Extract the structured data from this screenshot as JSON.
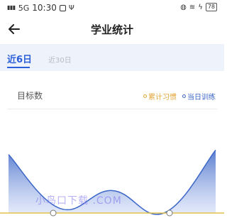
{
  "status_bar": {
    "signal": "5G",
    "time": "10:30",
    "battery": "78"
  },
  "header": {
    "title": "学业统计",
    "back_icon": "arrow-left-icon"
  },
  "tabs": [
    {
      "label": "近6日",
      "active": true
    },
    {
      "label": "近30日",
      "active": false
    }
  ],
  "metric": {
    "label": "目标数"
  },
  "legend": [
    {
      "label": "累计习惯",
      "color": "#e3a63a"
    },
    {
      "label": "当日训练",
      "color": "#3c66c7"
    }
  ],
  "colors": {
    "accent": "#2b5fd9",
    "area_top": "#3c66c7",
    "baseline": "#e3c24a"
  },
  "chart_data": {
    "type": "area",
    "series": [
      {
        "name": "当日训练",
        "values": [
          5.2,
          0.4,
          2.0,
          0.0,
          5.6
        ]
      }
    ],
    "ylim": [
      0,
      6
    ]
  },
  "watermark": "小鸟口下载 .COM"
}
